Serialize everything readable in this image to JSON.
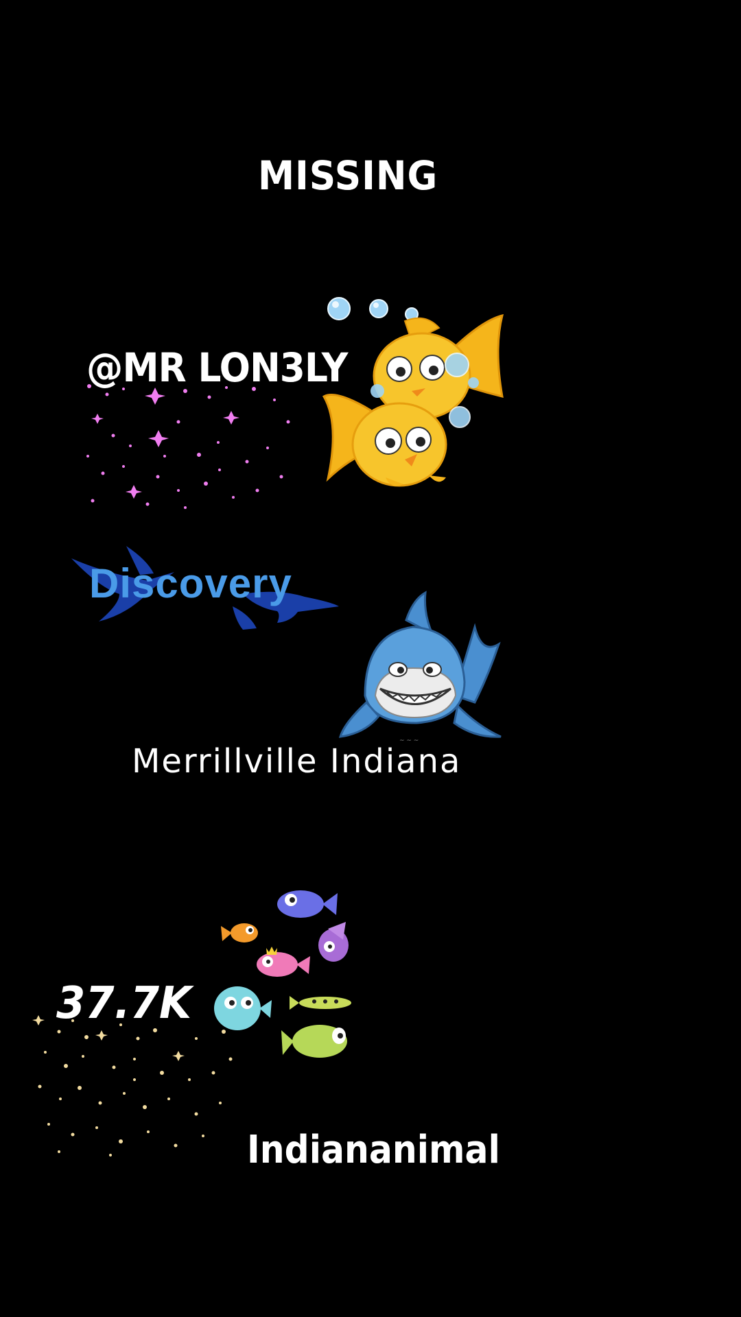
{
  "texts": {
    "title": "MISSING",
    "handle": "@MR LON3LY",
    "brand": "Discovery",
    "location": "Merrillville Indiana",
    "count": "37.7K",
    "name": "Indiananimal"
  },
  "icons": {
    "goldfish": "goldfish-emoji-icon",
    "bubbles": "bubbles-icon",
    "sparkles_pink": "pink-sparkles-icon",
    "sharks_bg": "sharks-silhouette-icon",
    "cartoon_shark": "cartoon-shark-icon",
    "fish_group": "cartoon-fish-group-icon",
    "sparkles_gold": "gold-sparkles-icon"
  },
  "colors": {
    "background": "#000000",
    "text": "#ffffff",
    "discovery_blue": "#4a9be8",
    "sparkle_pink": "#f07ef0",
    "sparkle_gold": "#f3dca0"
  }
}
